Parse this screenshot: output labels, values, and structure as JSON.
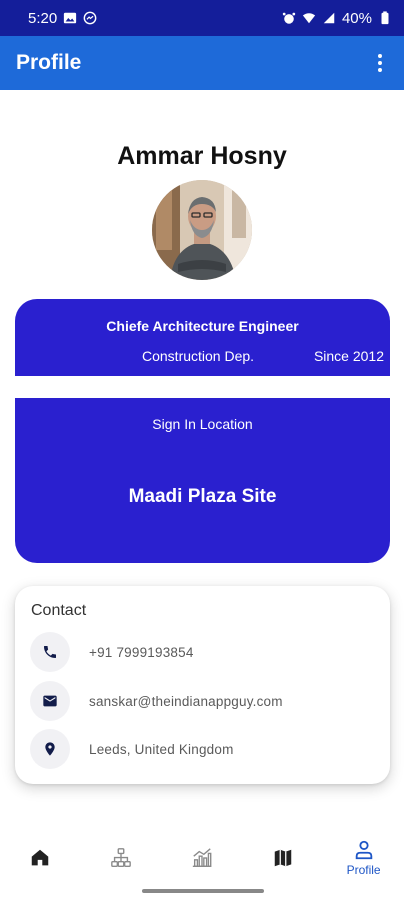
{
  "status_bar": {
    "time": "5:20",
    "battery": "40%",
    "left_icons": [
      "image-icon",
      "messenger-icon"
    ],
    "right_icons": [
      "alarm-icon",
      "wifi-icon",
      "signal-icon",
      "battery-icon"
    ]
  },
  "app_bar": {
    "title": "Profile",
    "menu_icon": "more-vert-icon",
    "color": "#1e6ad9"
  },
  "profile": {
    "name": "Ammar Hosny"
  },
  "role": {
    "title": "Chiefe Architecture Engineer",
    "department": "Construction Dep.",
    "since": "Since 2012"
  },
  "location": {
    "label": "Sign In Location",
    "value": "Maadi Plaza Site"
  },
  "contact": {
    "heading": "Contact",
    "items": [
      {
        "icon": "phone-icon",
        "text": "+91 7999193854"
      },
      {
        "icon": "mail-icon",
        "text": "sanskar@theindianappguy.com"
      },
      {
        "icon": "location-pin-icon",
        "text": "Leeds, United Kingdom"
      }
    ]
  },
  "bottom_nav": {
    "items": [
      {
        "icon": "home-icon",
        "label": ""
      },
      {
        "icon": "org-chart-icon",
        "label": ""
      },
      {
        "icon": "analytics-icon",
        "label": ""
      },
      {
        "icon": "map-icon",
        "label": ""
      },
      {
        "icon": "profile-icon",
        "label": "Profile",
        "active": true
      }
    ]
  },
  "colors": {
    "status_bar": "#141e9a",
    "card": "#2a20cf",
    "active_nav": "#1e56c6",
    "inactive_nav": "#8a8a8a"
  }
}
